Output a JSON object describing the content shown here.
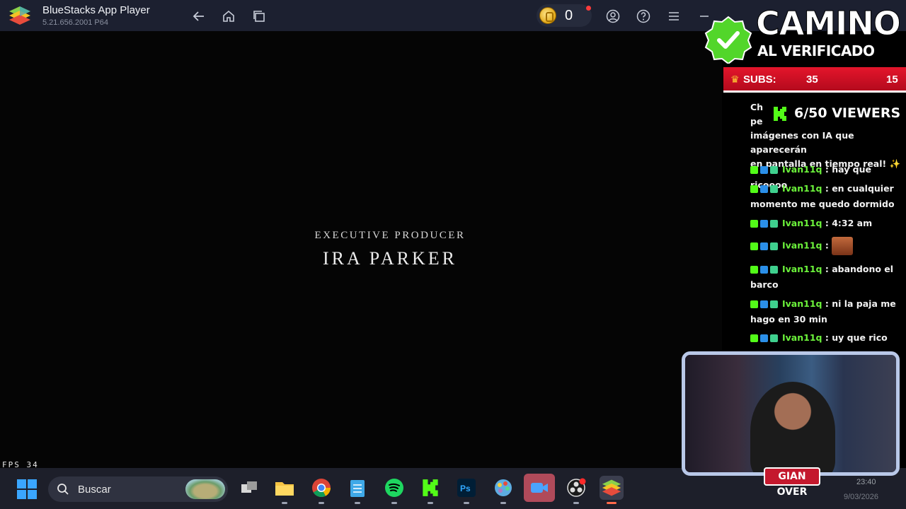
{
  "window": {
    "title": "BlueStacks App Player",
    "version": "5.21.656.2001 P64",
    "coins": "0"
  },
  "player": {
    "credit_role": "EXECUTIVE PRODUCER",
    "credit_name": "IRA PARKER",
    "fps_label": "FPS 34"
  },
  "overlay": {
    "title_line1": "CAMINO",
    "title_line2": "AL VERIFICADO",
    "subs_label": "SUBS:",
    "subs_current": "35",
    "subs_goal": "15",
    "viewers": "6/50 VIEWERS",
    "system_message": "Ch... pe... imágenes con IA que aparecerán en pantalla en tiempo real! ✨",
    "system_line1": "Ch",
    "system_line2": "pe",
    "system_line3": "imágenes con IA que aparecerán",
    "system_line4": "en pantalla en tiempo real! ✨",
    "chat": [
      {
        "user": "Ivan11q",
        "text": ": hay que ricoooo"
      },
      {
        "user": "Ivan11q",
        "text": ": en cualquier momento me quedo dormido"
      },
      {
        "user": "Ivan11q",
        "text": ": 4:32 am"
      },
      {
        "user": "Ivan11q",
        "text": ":"
      },
      {
        "user": "Ivan11q",
        "text": ": abandono el barco"
      },
      {
        "user": "Ivan11q",
        "text": ": ni la paja me hago en 30 min"
      },
      {
        "user": "Ivan11q",
        "text": ": uy que rico"
      }
    ],
    "webcam_label": "GIAN OVER"
  },
  "taskbar": {
    "search_placeholder": "Buscar",
    "apps": [
      "start-icon",
      "task-view-icon",
      "file-explorer-icon",
      "chrome-icon",
      "notepad-icon",
      "spotify-icon",
      "kick-icon",
      "photoshop-icon",
      "paint-icon",
      "video-editor-icon",
      "obs-icon",
      "bluestacks-icon"
    ],
    "time": "23:40",
    "date": "9/03/2026"
  },
  "colors": {
    "titlebar": "#1c2030",
    "kick_green": "#53fc18",
    "subs_red": "#d11026",
    "taskbar": "#1d1f2a"
  }
}
